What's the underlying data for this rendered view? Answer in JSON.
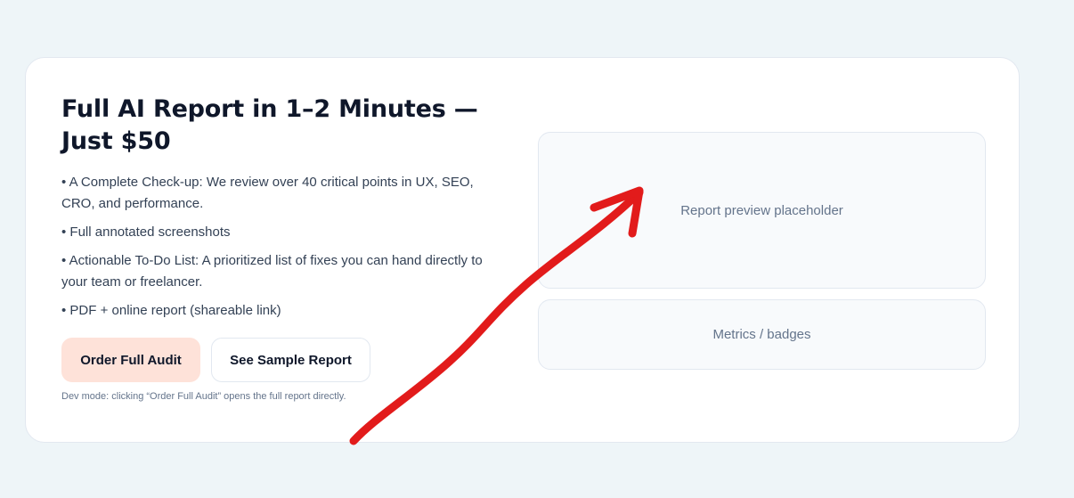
{
  "hero": {
    "title": "Full AI Report in 1–2 Minutes — Just $50",
    "bullets": [
      "• A Complete Check-up: We review over 40 critical points in UX, SEO, CRO, and performance.",
      "• Full annotated screenshots",
      "• Actionable To-Do List: A prioritized list of fixes you can hand directly to your team or freelancer.",
      "• PDF + online report (shareable link)"
    ],
    "primary_button": "Order Full Audit",
    "secondary_button": "See Sample Report",
    "dev_note": "Dev mode: clicking “Order Full Audit” opens the full report directly."
  },
  "preview": {
    "placeholder": "Report preview placeholder",
    "metrics_placeholder": "Metrics / badges"
  },
  "annotation": {
    "arrow_color": "#e21b1b"
  },
  "colors": {
    "page_bg": "#eef5f8",
    "primary_button_bg": "#fee2d9",
    "title_color": "#0f172a"
  }
}
